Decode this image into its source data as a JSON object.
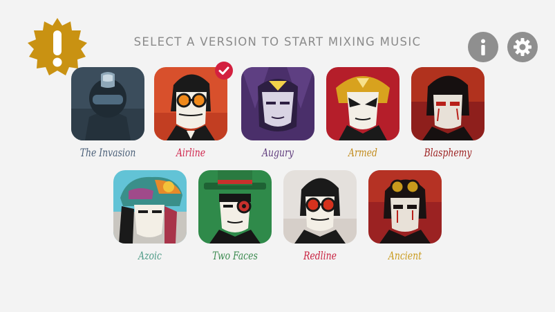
{
  "header": {
    "title": "SELECT A VERSION TO START MIXING MUSIC"
  },
  "top_controls": {
    "alert_icon": "exclamation-icon",
    "info_icon": "info-icon",
    "settings_icon": "gear-icon"
  },
  "colors": {
    "background": "#f3f3f3",
    "title_text": "#8a8a8a",
    "control_button": "#8f8f8f",
    "alert_badge": "#c99212",
    "selected_check": "#d3203f"
  },
  "versions": [
    {
      "label": "The Invasion",
      "color": "#4a5f78",
      "selected": false
    },
    {
      "label": "Airline",
      "color": "#d0254c",
      "selected": true
    },
    {
      "label": "Augury",
      "color": "#5e3a7c",
      "selected": false
    },
    {
      "label": "Armed",
      "color": "#c28c1e",
      "selected": false
    },
    {
      "label": "Blasphemy",
      "color": "#9b1e1e",
      "selected": false
    },
    {
      "label": "Azoic",
      "color": "#4d9a86",
      "selected": false
    },
    {
      "label": "Two Faces",
      "color": "#3b8a4f",
      "selected": false
    },
    {
      "label": "Redline",
      "color": "#c81f3e",
      "selected": false
    },
    {
      "label": "Ancient",
      "color": "#c99a1c",
      "selected": false
    }
  ]
}
